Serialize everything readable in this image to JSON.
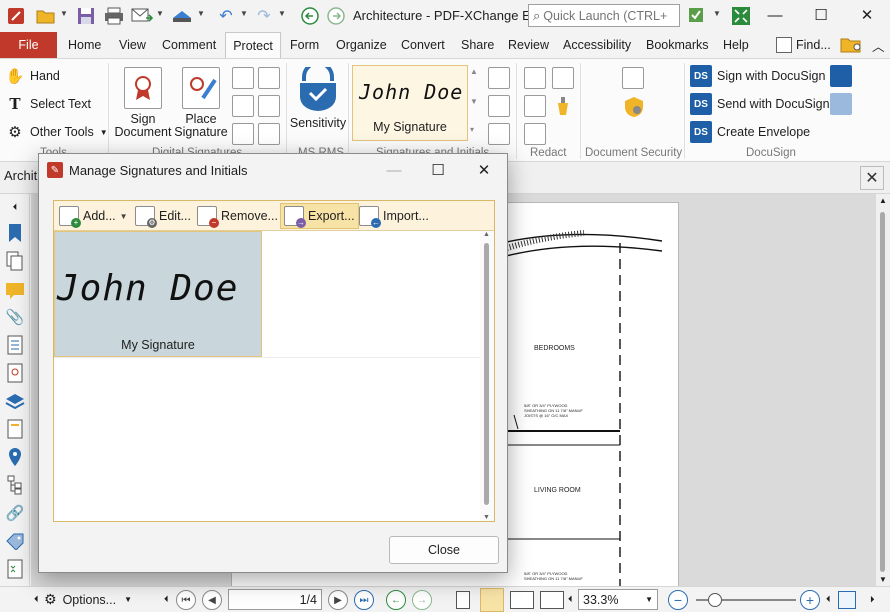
{
  "window": {
    "title": "Architecture - PDF-XChange Ed...",
    "quick_launch_placeholder": "Quick Launch (CTRL+.)",
    "minimize": "—",
    "maximize": "☐",
    "close": "✕"
  },
  "ribbon_tabs": [
    "File",
    "Home",
    "View",
    "Comment",
    "Protect",
    "Form",
    "Organize",
    "Convert",
    "Share",
    "Review",
    "Accessibility",
    "Bookmarks",
    "Help"
  ],
  "active_tab": "Protect",
  "find_label": "Find...",
  "ribbon": {
    "tools": {
      "hand": "Hand",
      "select_text": "Select Text",
      "other_tools": "Other Tools",
      "group_label": "Tools"
    },
    "digital_signatures": {
      "sign_document": "Sign\nDocument",
      "place_signature": "Place\nSignature",
      "group_label": "Digital Signatures"
    },
    "ms_rms": {
      "sensitivity": "Sensitivity",
      "group_label": "MS RMS"
    },
    "signatures_initials": {
      "preview_text": "John  Doe",
      "preview_caption": "My Signature",
      "group_label": "Signatures and Initials"
    },
    "redact": {
      "group_label": "Redact"
    },
    "document_security": {
      "group_label": "Document Security"
    },
    "docusign": {
      "sign_with": "Sign with DocuSign",
      "send_with": "Send with DocuSign",
      "create_envelope": "Create Envelope",
      "group_label": "DocuSign"
    }
  },
  "document_tab": {
    "name": "Archit",
    "close": "✕"
  },
  "drawing_labels": {
    "bedrooms": "BEDROOMS",
    "living_room": "LIVING ROOM",
    "note1": "5/8\" OR 3/4\" PLYWOOD\nSHEATHING ON 11 7/8\" MANUF\nJOISTS @ 16\" O/C MAX",
    "note2": "5/8\" OR 3/4\" PLYWOOD\nSHEATHING ON 11 7/8\" MANUF"
  },
  "statusbar": {
    "options": "Options...",
    "page_indicator": "1/4",
    "zoom": "33.3%"
  },
  "dialog": {
    "title": "Manage Signatures and Initials",
    "toolbar": {
      "add": "Add...",
      "edit": "Edit...",
      "remove": "Remove...",
      "export": "Export...",
      "import": "Import..."
    },
    "signatures": [
      {
        "script": "John  Doe",
        "label": "My Signature"
      }
    ],
    "close_button": "Close"
  },
  "colors": {
    "file_tab": "#c0392b",
    "accent_border": "#d9b867",
    "selected_card": "#c9d7dc",
    "docusign": "#1f5fa8"
  }
}
